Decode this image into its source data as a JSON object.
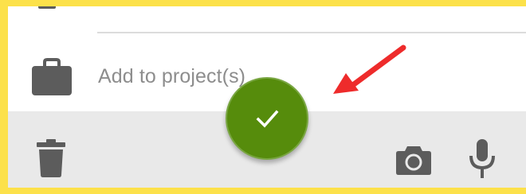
{
  "colors": {
    "frame": "#fce14a",
    "panel": "#ffffff",
    "bottom_bar": "#e9e9e9",
    "icon": "#5c5c5c",
    "fab": "#568c0c",
    "arrow": "#ee2b2b"
  },
  "form": {
    "project_field": {
      "icon": "briefcase-icon",
      "label": "Add to project(s)"
    }
  },
  "toolbar": {
    "delete_icon": "trash-icon",
    "camera_icon": "camera-icon",
    "mic_icon": "microphone-icon",
    "fab_icon": "checkmark-icon"
  },
  "annotation": {
    "icon": "red-arrow-annotation"
  }
}
